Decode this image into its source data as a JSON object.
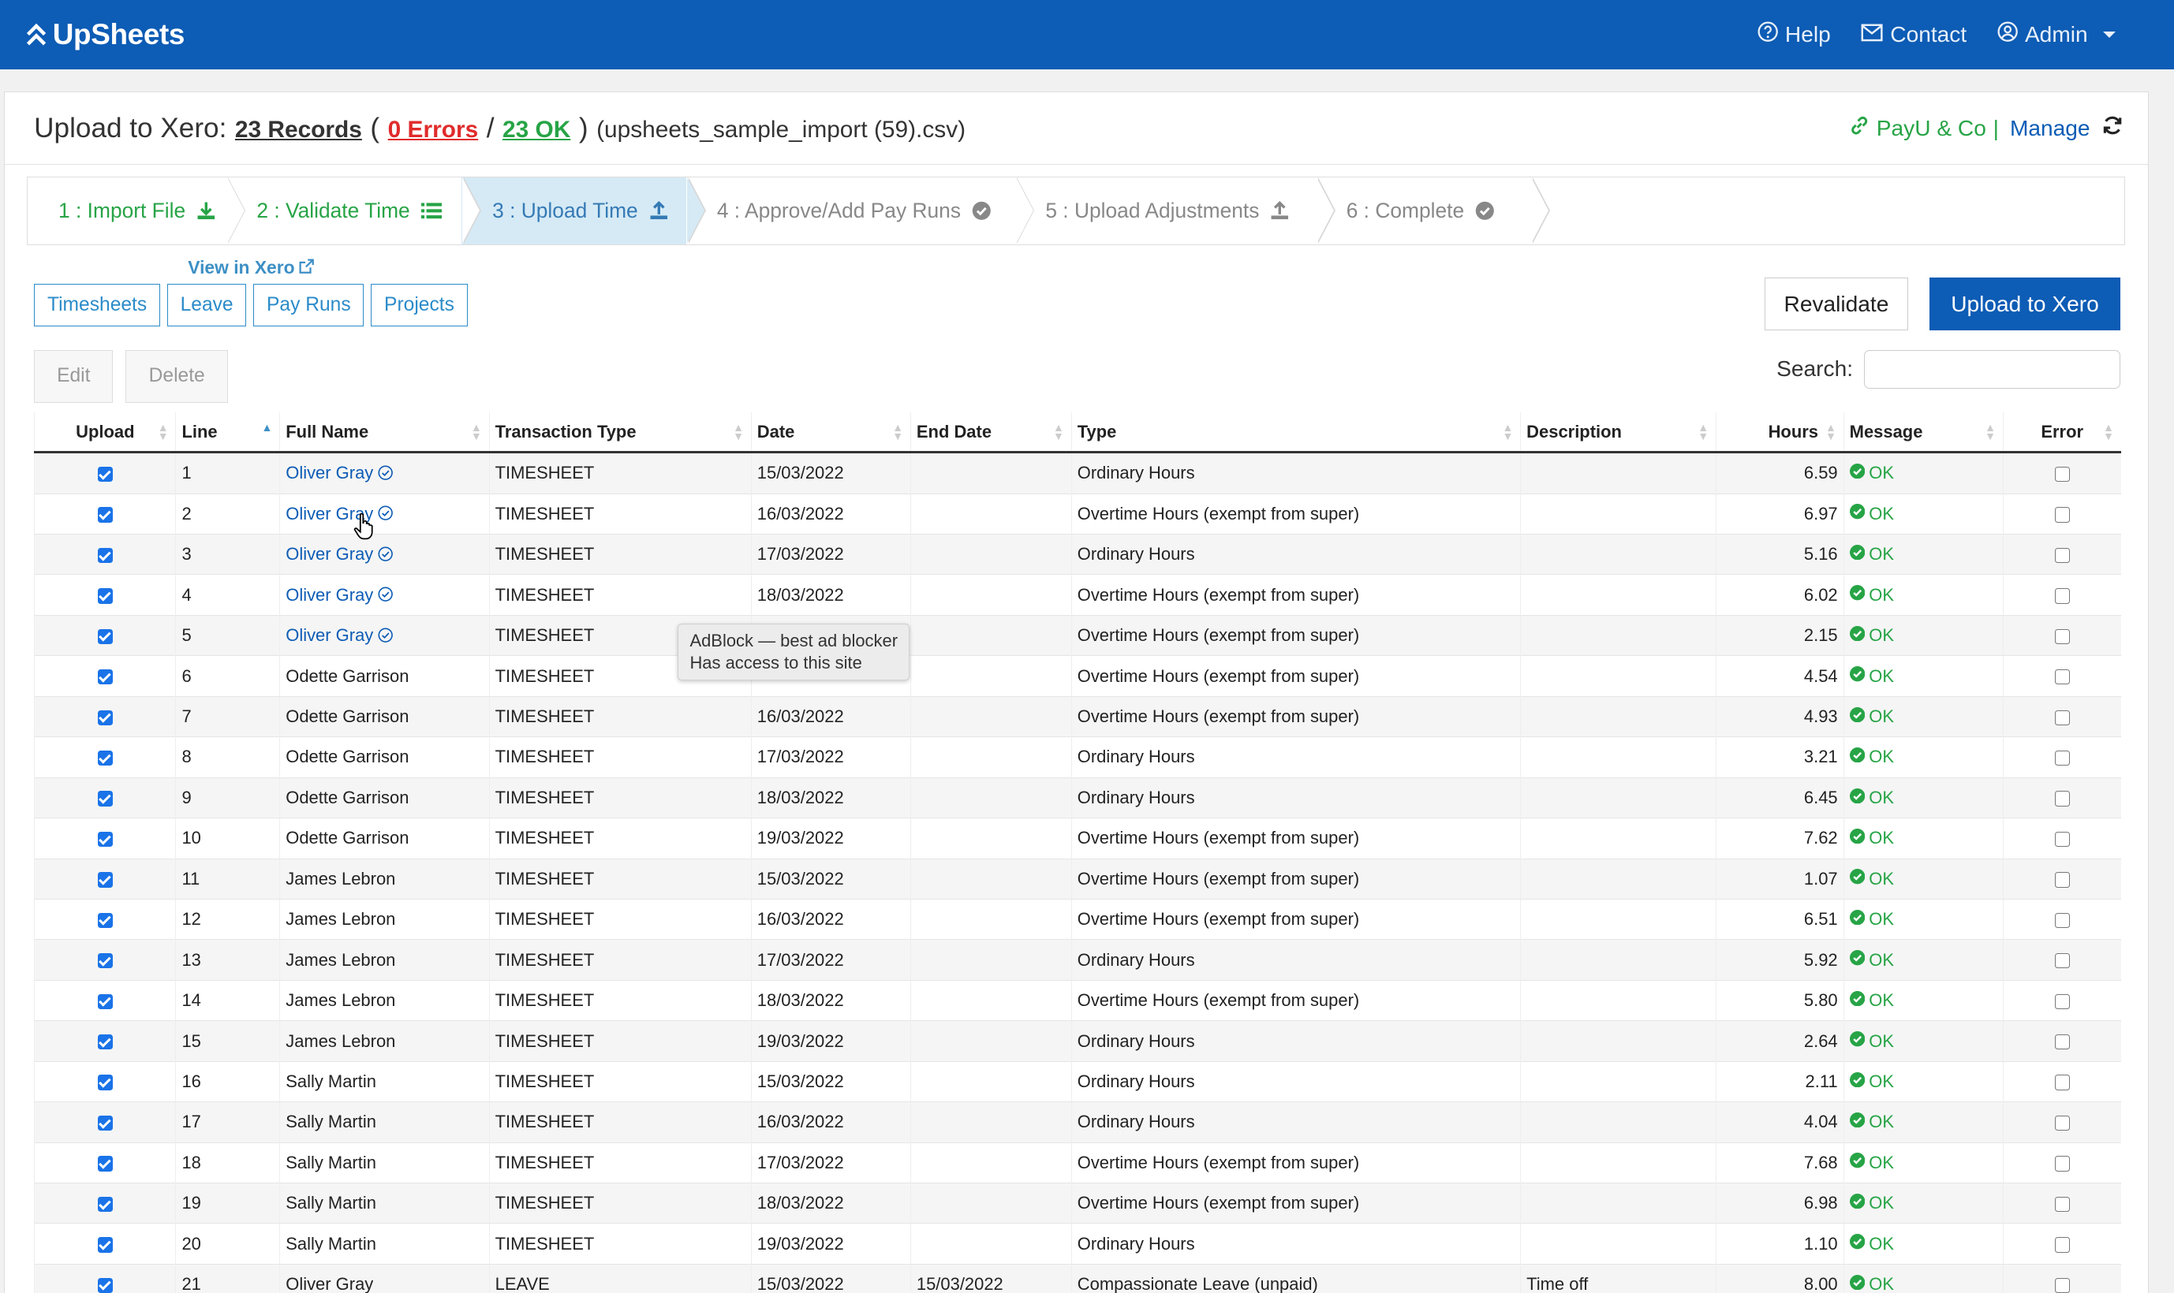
{
  "app": {
    "brand": "UpSheets",
    "nav": {
      "help": "Help",
      "contact": "Contact",
      "admin": "Admin"
    }
  },
  "header": {
    "prefix": "Upload to Xero:",
    "records": "23 Records",
    "open_paren": "(",
    "errors": "0 Errors",
    "slash": "/",
    "ok": "23 OK",
    "close_paren": ")",
    "filename": "(upsheets_sample_import (59).csv)",
    "org": "PayU & Co",
    "sep": "|",
    "manage": "Manage"
  },
  "steps": [
    {
      "label": "1 : Import File",
      "state": "done"
    },
    {
      "label": "2 : Validate Time",
      "state": "done"
    },
    {
      "label": "3 : Upload Time",
      "state": "active"
    },
    {
      "label": "4 : Approve/Add Pay Runs",
      "state": "pending"
    },
    {
      "label": "5 : Upload Adjustments",
      "state": "pending"
    },
    {
      "label": "6 : Complete",
      "state": "pending"
    }
  ],
  "view_in_xero": "View in Xero",
  "tabs": {
    "timesheets": "Timesheets",
    "leave": "Leave",
    "pay_runs": "Pay Runs",
    "projects": "Projects"
  },
  "actions": {
    "revalidate": "Revalidate",
    "upload": "Upload to Xero",
    "edit": "Edit",
    "delete": "Delete",
    "search_label": "Search:",
    "search_value": ""
  },
  "table": {
    "headers": [
      "Upload",
      "Line",
      "Full Name",
      "Transaction Type",
      "Date",
      "End Date",
      "Type",
      "Description",
      "Hours",
      "Message",
      "Error"
    ],
    "rows": [
      {
        "upload": true,
        "line": "1",
        "name": "Oliver Gray",
        "linked": true,
        "ttype": "TIMESHEET",
        "date": "15/03/2022",
        "end": "",
        "type": "Ordinary Hours",
        "desc": "",
        "hours": "6.59",
        "msg": "OK",
        "error": false
      },
      {
        "upload": true,
        "line": "2",
        "name": "Oliver Gray",
        "linked": true,
        "ttype": "TIMESHEET",
        "date": "16/03/2022",
        "end": "",
        "type": "Overtime Hours (exempt from super)",
        "desc": "",
        "hours": "6.97",
        "msg": "OK",
        "error": false
      },
      {
        "upload": true,
        "line": "3",
        "name": "Oliver Gray",
        "linked": true,
        "ttype": "TIMESHEET",
        "date": "17/03/2022",
        "end": "",
        "type": "Ordinary Hours",
        "desc": "",
        "hours": "5.16",
        "msg": "OK",
        "error": false
      },
      {
        "upload": true,
        "line": "4",
        "name": "Oliver Gray",
        "linked": true,
        "ttype": "TIMESHEET",
        "date": "18/03/2022",
        "end": "",
        "type": "Overtime Hours (exempt from super)",
        "desc": "",
        "hours": "6.02",
        "msg": "OK",
        "error": false
      },
      {
        "upload": true,
        "line": "5",
        "name": "Oliver Gray",
        "linked": true,
        "ttype": "TIMESHEET",
        "date": "",
        "end": "",
        "type": "Overtime Hours (exempt from super)",
        "desc": "",
        "hours": "2.15",
        "msg": "OK",
        "error": false
      },
      {
        "upload": true,
        "line": "6",
        "name": "Odette Garrison",
        "linked": false,
        "ttype": "TIMESHEET",
        "date": "",
        "end": "",
        "type": "Overtime Hours (exempt from super)",
        "desc": "",
        "hours": "4.54",
        "msg": "OK",
        "error": false
      },
      {
        "upload": true,
        "line": "7",
        "name": "Odette Garrison",
        "linked": false,
        "ttype": "TIMESHEET",
        "date": "16/03/2022",
        "end": "",
        "type": "Overtime Hours (exempt from super)",
        "desc": "",
        "hours": "4.93",
        "msg": "OK",
        "error": false
      },
      {
        "upload": true,
        "line": "8",
        "name": "Odette Garrison",
        "linked": false,
        "ttype": "TIMESHEET",
        "date": "17/03/2022",
        "end": "",
        "type": "Ordinary Hours",
        "desc": "",
        "hours": "3.21",
        "msg": "OK",
        "error": false
      },
      {
        "upload": true,
        "line": "9",
        "name": "Odette Garrison",
        "linked": false,
        "ttype": "TIMESHEET",
        "date": "18/03/2022",
        "end": "",
        "type": "Ordinary Hours",
        "desc": "",
        "hours": "6.45",
        "msg": "OK",
        "error": false
      },
      {
        "upload": true,
        "line": "10",
        "name": "Odette Garrison",
        "linked": false,
        "ttype": "TIMESHEET",
        "date": "19/03/2022",
        "end": "",
        "type": "Overtime Hours (exempt from super)",
        "desc": "",
        "hours": "7.62",
        "msg": "OK",
        "error": false
      },
      {
        "upload": true,
        "line": "11",
        "name": "James Lebron",
        "linked": false,
        "ttype": "TIMESHEET",
        "date": "15/03/2022",
        "end": "",
        "type": "Overtime Hours (exempt from super)",
        "desc": "",
        "hours": "1.07",
        "msg": "OK",
        "error": false
      },
      {
        "upload": true,
        "line": "12",
        "name": "James Lebron",
        "linked": false,
        "ttype": "TIMESHEET",
        "date": "16/03/2022",
        "end": "",
        "type": "Overtime Hours (exempt from super)",
        "desc": "",
        "hours": "6.51",
        "msg": "OK",
        "error": false
      },
      {
        "upload": true,
        "line": "13",
        "name": "James Lebron",
        "linked": false,
        "ttype": "TIMESHEET",
        "date": "17/03/2022",
        "end": "",
        "type": "Ordinary Hours",
        "desc": "",
        "hours": "5.92",
        "msg": "OK",
        "error": false
      },
      {
        "upload": true,
        "line": "14",
        "name": "James Lebron",
        "linked": false,
        "ttype": "TIMESHEET",
        "date": "18/03/2022",
        "end": "",
        "type": "Overtime Hours (exempt from super)",
        "desc": "",
        "hours": "5.80",
        "msg": "OK",
        "error": false
      },
      {
        "upload": true,
        "line": "15",
        "name": "James Lebron",
        "linked": false,
        "ttype": "TIMESHEET",
        "date": "19/03/2022",
        "end": "",
        "type": "Ordinary Hours",
        "desc": "",
        "hours": "2.64",
        "msg": "OK",
        "error": false
      },
      {
        "upload": true,
        "line": "16",
        "name": "Sally Martin",
        "linked": false,
        "ttype": "TIMESHEET",
        "date": "15/03/2022",
        "end": "",
        "type": "Ordinary Hours",
        "desc": "",
        "hours": "2.11",
        "msg": "OK",
        "error": false
      },
      {
        "upload": true,
        "line": "17",
        "name": "Sally Martin",
        "linked": false,
        "ttype": "TIMESHEET",
        "date": "16/03/2022",
        "end": "",
        "type": "Ordinary Hours",
        "desc": "",
        "hours": "4.04",
        "msg": "OK",
        "error": false
      },
      {
        "upload": true,
        "line": "18",
        "name": "Sally Martin",
        "linked": false,
        "ttype": "TIMESHEET",
        "date": "17/03/2022",
        "end": "",
        "type": "Overtime Hours (exempt from super)",
        "desc": "",
        "hours": "7.68",
        "msg": "OK",
        "error": false
      },
      {
        "upload": true,
        "line": "19",
        "name": "Sally Martin",
        "linked": false,
        "ttype": "TIMESHEET",
        "date": "18/03/2022",
        "end": "",
        "type": "Overtime Hours (exempt from super)",
        "desc": "",
        "hours": "6.98",
        "msg": "OK",
        "error": false
      },
      {
        "upload": true,
        "line": "20",
        "name": "Sally Martin",
        "linked": false,
        "ttype": "TIMESHEET",
        "date": "19/03/2022",
        "end": "",
        "type": "Ordinary Hours",
        "desc": "",
        "hours": "1.10",
        "msg": "OK",
        "error": false
      },
      {
        "upload": true,
        "line": "21",
        "name": "Oliver Gray",
        "linked": false,
        "ttype": "LEAVE",
        "date": "15/03/2022",
        "end": "15/03/2022",
        "type": "Compassionate Leave (unpaid)",
        "desc": "Time off",
        "hours": "8.00",
        "msg": "OK",
        "error": false
      }
    ]
  },
  "tooltip": {
    "line1": "AdBlock — best ad blocker",
    "line2": "Has access to this site"
  },
  "colors": {
    "brand": "#0d5cb5",
    "ok": "#27a446",
    "error": "#e02b2b",
    "step_active": "#d5eaf5",
    "tab_border": "#2b8bc9"
  }
}
